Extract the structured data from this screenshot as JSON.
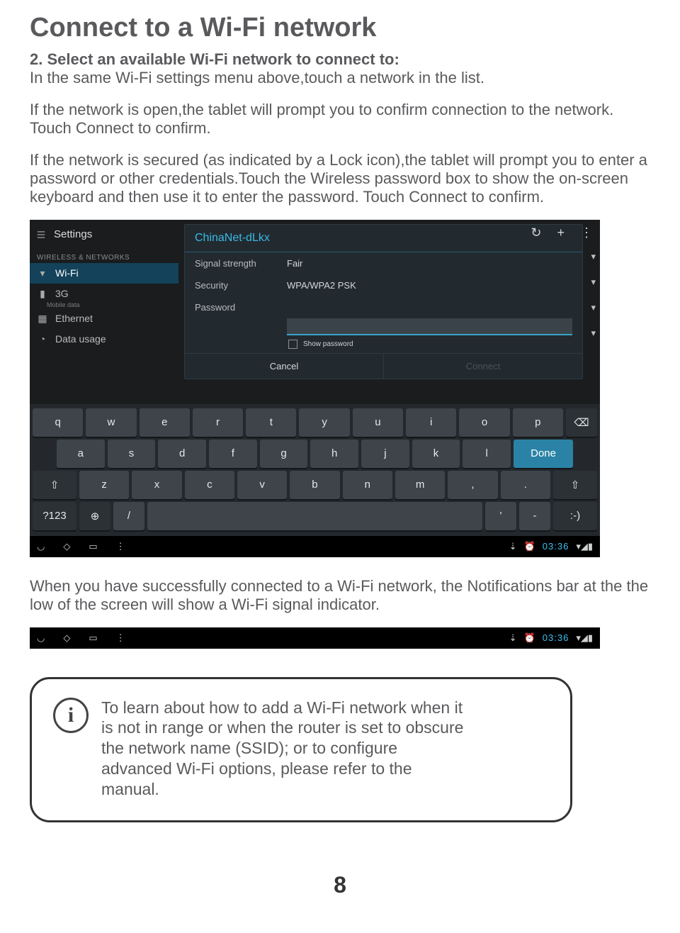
{
  "h1": "Connect to a Wi-Fi network",
  "p1a": "2. Select an available Wi-Fi network to connect to:",
  "p1b": "In the same Wi-Fi settings menu above,touch a network in the list.",
  "p2": "If the network is open,the tablet will prompt you to confirm connection to the network. Touch Connect to confirm.",
  "p3": "If the network is secured (as indicated by a Lock icon),the tablet will prompt you to enter a password or other credentials.Touch the Wireless password box to show the on-screen keyboard and then use it to enter the password. Touch Connect to confirm.",
  "p4": "When you have successfully connected to a Wi-Fi network, the Notifications bar at the the low of the screen will show a Wi-Fi signal indicator.",
  "tip": "To learn about how to add a Wi-Fi network when it is not in range or when the router is set to obscure the network name (SSID); or to configure advanced Wi-Fi options, please refer to the manual.",
  "pagenum": "8",
  "device": {
    "sidebar": {
      "title": "Settings",
      "wireless_header": "WIRELESS & NETWORKS",
      "wifi": "Wi-Fi",
      "g3": "3G",
      "g3_sub": "Mobile data",
      "ethernet": "Ethernet",
      "data": "Data usage"
    },
    "topright": {
      "refresh": "↻",
      "plus": "+",
      "more": "⋮"
    },
    "dialog": {
      "ssid": "ChinaNet-dLkx",
      "signal_l": "Signal strength",
      "signal_v": "Fair",
      "security_l": "Security",
      "security_v": "WPA/WPA2 PSK",
      "password_l": "Password",
      "show_pass": "Show password",
      "cancel": "Cancel",
      "connect": "Connect"
    },
    "keyboard": {
      "r1": [
        "q",
        "w",
        "e",
        "r",
        "t",
        "y",
        "u",
        "i",
        "o",
        "p"
      ],
      "backspace": "⌫",
      "r2": [
        "a",
        "s",
        "d",
        "f",
        "g",
        "h",
        "j",
        "k",
        "l"
      ],
      "done": "Done",
      "shift": "⇧",
      "r3": [
        "z",
        "x",
        "c",
        "v",
        "b",
        "n",
        "m",
        ",",
        "."
      ],
      "num": "?123",
      "globe": "⊕",
      "slash": "/",
      "smile": ":-)"
    },
    "nav": {
      "back": "◡",
      "home": "◇",
      "recent": "▭",
      "more": "⋮",
      "time": "03:36"
    }
  }
}
